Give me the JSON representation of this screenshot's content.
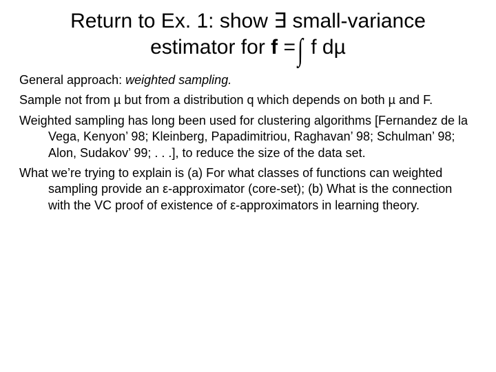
{
  "title": {
    "line1_prefix": "Return to Ex. 1: show ",
    "exists": "∃",
    "line1_suffix": " small-variance",
    "line2_prefix": "estimator for ",
    "fbar": "f",
    "eq": " =",
    "integral": "∫",
    "f": " f d",
    "mu": "µ"
  },
  "body": {
    "p1_prefix": "General approach: ",
    "p1_em": "weighted sampling.",
    "p2": "Sample not from µ but from a distribution q which depends on both µ and F.",
    "p3": "Weighted sampling has long been used for clustering algorithms [Fernandez de la Vega, Kenyon’ 98; Kleinberg, Papadimitriou, Raghavan’ 98; Schulman’ 98; Alon, Sudakov’ 99; . . .], to reduce the size of the data set.",
    "p4": "What we’re trying to explain is (a) For what classes of functions can weighted sampling provide an ε-approximator (core-set); (b) What is the connection with the VC proof of existence of ε-approximators in learning theory."
  }
}
